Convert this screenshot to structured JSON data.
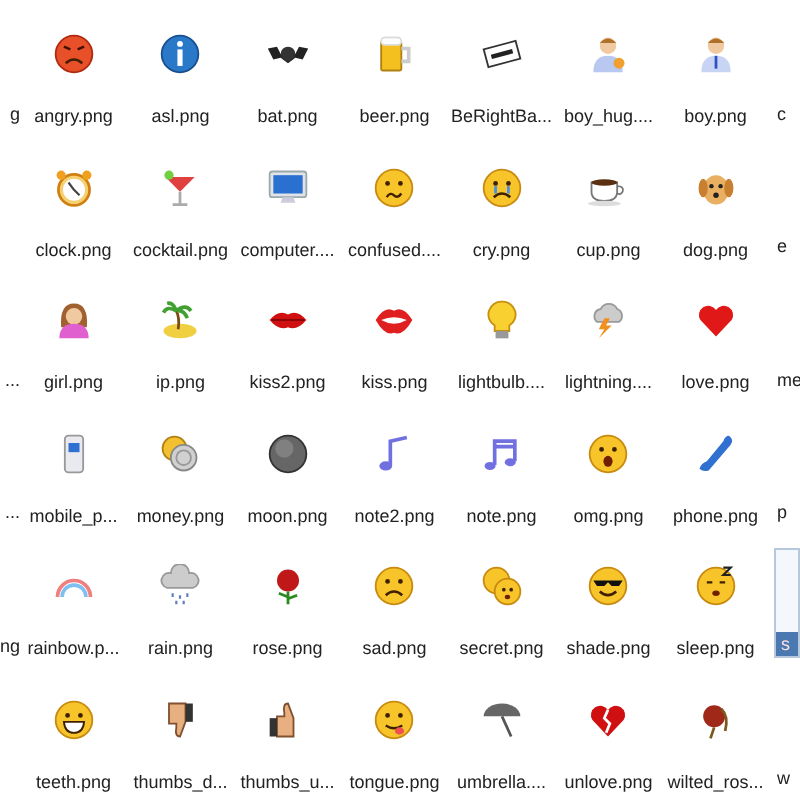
{
  "rows": [
    {
      "left": {
        "label": "g",
        "selected": false
      },
      "items": [
        {
          "label": "angry.png",
          "selected": false
        },
        {
          "label": "asl.png",
          "selected": false
        },
        {
          "label": "bat.png",
          "selected": false
        },
        {
          "label": "beer.png",
          "selected": false
        },
        {
          "label": "BeRightBa...",
          "selected": false
        },
        {
          "label": "boy_hug....",
          "selected": false
        },
        {
          "label": "boy.png",
          "selected": false
        }
      ],
      "right": {
        "label": "c",
        "selected": false
      }
    },
    {
      "items": [
        {
          "label": "clock.png",
          "selected": false
        },
        {
          "label": "cocktail.png",
          "selected": false
        },
        {
          "label": "computer....",
          "selected": false
        },
        {
          "label": "confused....",
          "selected": false
        },
        {
          "label": "cry.png",
          "selected": false
        },
        {
          "label": "cup.png",
          "selected": false
        },
        {
          "label": "dog.png",
          "selected": false
        }
      ],
      "right": {
        "label": "e",
        "selected": false
      }
    },
    {
      "left": {
        "label": "...",
        "selected": false
      },
      "items": [
        {
          "label": "girl.png",
          "selected": false
        },
        {
          "label": "ip.png",
          "selected": false
        },
        {
          "label": "kiss2.png",
          "selected": false
        },
        {
          "label": "kiss.png",
          "selected": false
        },
        {
          "label": "lightbulb....",
          "selected": false
        },
        {
          "label": "lightning....",
          "selected": false
        },
        {
          "label": "love.png",
          "selected": false
        }
      ],
      "right": {
        "label": "me",
        "selected": false
      }
    },
    {
      "left": {
        "label": "...",
        "selected": false
      },
      "items": [
        {
          "label": "mobile_p...",
          "selected": false
        },
        {
          "label": "money.png",
          "selected": false
        },
        {
          "label": "moon.png",
          "selected": false
        },
        {
          "label": "note2.png",
          "selected": false
        },
        {
          "label": "note.png",
          "selected": false
        },
        {
          "label": "omg.png",
          "selected": false
        },
        {
          "label": "phone.png",
          "selected": false
        }
      ],
      "right": {
        "label": "p",
        "selected": false
      }
    },
    {
      "left": {
        "label": "ng",
        "selected": false
      },
      "items": [
        {
          "label": "rainbow.p...",
          "selected": false
        },
        {
          "label": "rain.png",
          "selected": false
        },
        {
          "label": "rose.png",
          "selected": false
        },
        {
          "label": "sad.png",
          "selected": false
        },
        {
          "label": "secret.png",
          "selected": false
        },
        {
          "label": "shade.png",
          "selected": false
        },
        {
          "label": "sleep.png",
          "selected": false
        }
      ],
      "right": {
        "label": "s",
        "selected": true
      }
    },
    {
      "items": [
        {
          "label": "teeth.png",
          "selected": false
        },
        {
          "label": "thumbs_d...",
          "selected": false
        },
        {
          "label": "thumbs_u...",
          "selected": false
        },
        {
          "label": "tongue.png",
          "selected": false
        },
        {
          "label": "umbrella....",
          "selected": false
        },
        {
          "label": "unlove.png",
          "selected": false
        },
        {
          "label": "wilted_ros...",
          "selected": false
        }
      ],
      "right": {
        "label": "w",
        "selected": false
      }
    }
  ]
}
